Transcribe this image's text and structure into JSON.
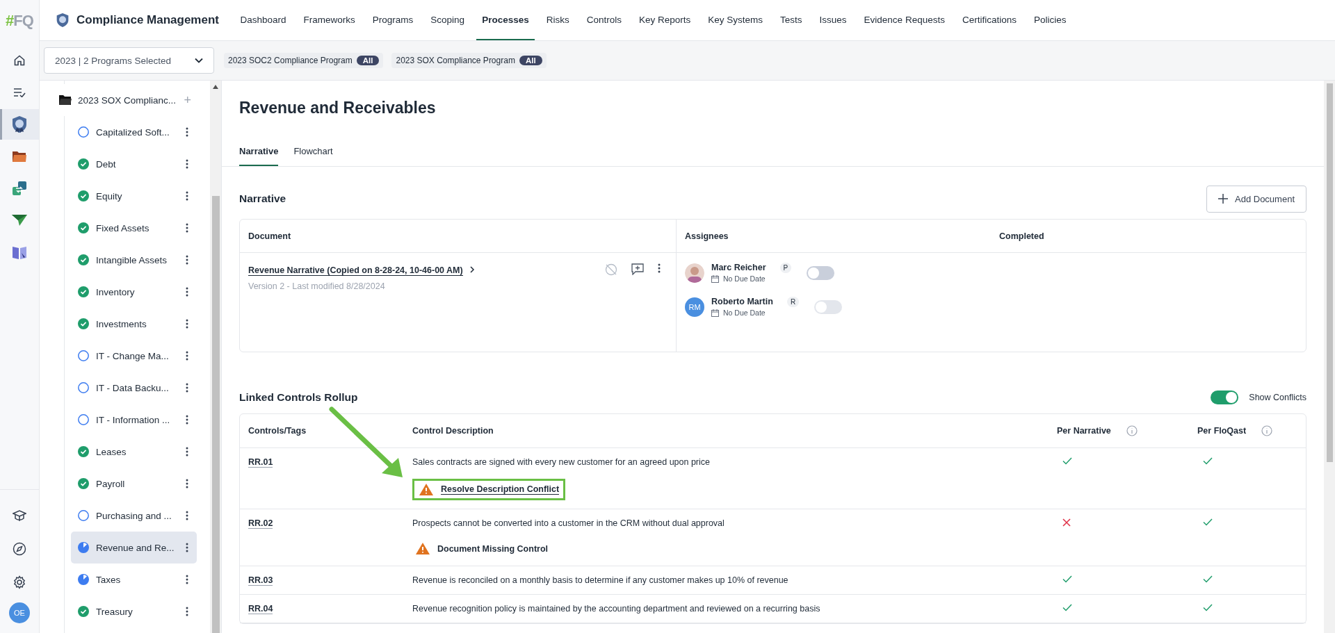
{
  "rail": {
    "logo_symbol": "#",
    "logo_letters": "FQ",
    "top_icons": [
      {
        "kind": "home",
        "selected": false
      },
      {
        "kind": "checklist",
        "selected": false
      },
      {
        "kind": "shield",
        "selected": true
      },
      {
        "kind": "folder",
        "selected": false
      },
      {
        "kind": "sync",
        "selected": false
      },
      {
        "kind": "plane",
        "selected": false
      },
      {
        "kind": "book",
        "selected": false
      }
    ],
    "bottom_icons": [
      {
        "kind": "cap"
      },
      {
        "kind": "compass"
      },
      {
        "kind": "settings"
      }
    ],
    "avatar": "OE"
  },
  "app": {
    "title": "Compliance Management",
    "nav": [
      {
        "label": "Dashboard",
        "selected": false
      },
      {
        "label": "Frameworks",
        "selected": false
      },
      {
        "label": "Programs",
        "selected": false
      },
      {
        "label": "Scoping",
        "selected": false
      },
      {
        "label": "Processes",
        "selected": true
      },
      {
        "label": "Risks",
        "selected": false
      },
      {
        "label": "Controls",
        "selected": false
      },
      {
        "label": "Key Reports",
        "selected": false
      },
      {
        "label": "Key Systems",
        "selected": false
      },
      {
        "label": "Tests",
        "selected": false
      },
      {
        "label": "Issues",
        "selected": false
      },
      {
        "label": "Evidence Requests",
        "selected": false
      },
      {
        "label": "Certifications",
        "selected": false
      },
      {
        "label": "Policies",
        "selected": false
      }
    ]
  },
  "filter": {
    "dropdown": "2023 | 2 Programs Selected",
    "chips": [
      {
        "label": "2023 SOC2 Compliance Program",
        "badge": "All"
      },
      {
        "label": "2023 SOX Compliance Program",
        "badge": "All"
      }
    ]
  },
  "tree": {
    "folder": "2023 SOX Complianc...",
    "folder_action": "+",
    "items": [
      {
        "label": "Capitalized Soft...",
        "kind": "todo",
        "selected": false
      },
      {
        "label": "Debt",
        "kind": "done",
        "selected": false
      },
      {
        "label": "Equity",
        "kind": "done",
        "selected": false
      },
      {
        "label": "Fixed Assets",
        "kind": "done",
        "selected": false
      },
      {
        "label": "Intangible Assets",
        "kind": "done",
        "selected": false
      },
      {
        "label": "Inventory",
        "kind": "done",
        "selected": false
      },
      {
        "label": "Investments",
        "kind": "done",
        "selected": false
      },
      {
        "label": "IT - Change Ma...",
        "kind": "todo",
        "selected": false
      },
      {
        "label": "IT - Data Backu...",
        "kind": "todo",
        "selected": false
      },
      {
        "label": "IT - Information ...",
        "kind": "todo",
        "selected": false
      },
      {
        "label": "Leases",
        "kind": "done",
        "selected": false
      },
      {
        "label": "Payroll",
        "kind": "done",
        "selected": false
      },
      {
        "label": "Purchasing and ...",
        "kind": "todo",
        "selected": false
      },
      {
        "label": "Revenue and Re...",
        "kind": "partial",
        "selected": true
      },
      {
        "label": "Taxes",
        "kind": "partial",
        "selected": false
      },
      {
        "label": "Treasury",
        "kind": "done",
        "selected": false
      }
    ]
  },
  "page": {
    "title": "Revenue and Receivables",
    "tabs": [
      {
        "label": "Narrative",
        "selected": true
      },
      {
        "label": "Flowchart",
        "selected": false
      }
    ]
  },
  "narrative": {
    "title": "Narrative",
    "add_button": "Add Document",
    "columns": [
      "Document",
      "Assignees",
      "Completed"
    ],
    "rows": [
      {
        "document": "Revenue Narrative (Copied on 8-28-24, 10-46-00 AM)",
        "meta": "Version 2 - Last modified 8/28/2024",
        "assignees": [
          {
            "name": "Marc Reicher",
            "role": "P",
            "due": "No Due Date",
            "completed": false,
            "disabled": false
          },
          {
            "name": "Roberto Martin",
            "kind": "initials",
            "initials": "RM",
            "role": "R",
            "due": "No Due Date",
            "completed": false,
            "disabled": true
          }
        ]
      }
    ]
  },
  "controls": {
    "title": "Linked Controls Rollup",
    "show_conflicts": {
      "label": "Show Conflicts",
      "on": true
    },
    "columns": [
      "Controls/Tags",
      "Control Description",
      "Per Narrative",
      "Per FloQast"
    ],
    "rows": [
      {
        "id": "RR.01",
        "description": "Sales contracts are signed with every new customer for an agreed upon price",
        "per_narrative": true,
        "per_floqast": true,
        "issue": {
          "kind": "conflict",
          "label": "Resolve Description Conflict",
          "highlighted": true
        }
      },
      {
        "id": "RR.02",
        "description": "Prospects cannot be converted into a customer in the CRM without dual approval",
        "per_narrative": false,
        "per_floqast": true,
        "issue": {
          "kind": "missing",
          "label": "Document Missing Control",
          "highlighted": false
        }
      },
      {
        "id": "RR.03",
        "description": "Revenue is reconciled on a monthly basis to determine if any customer makes up 10% of revenue",
        "per_narrative": true,
        "per_floqast": true
      },
      {
        "id": "RR.04",
        "description": "Revenue recognition policy is maintained by the accounting department and reviewed on a recurring basis",
        "per_narrative": true,
        "per_floqast": true
      }
    ]
  }
}
